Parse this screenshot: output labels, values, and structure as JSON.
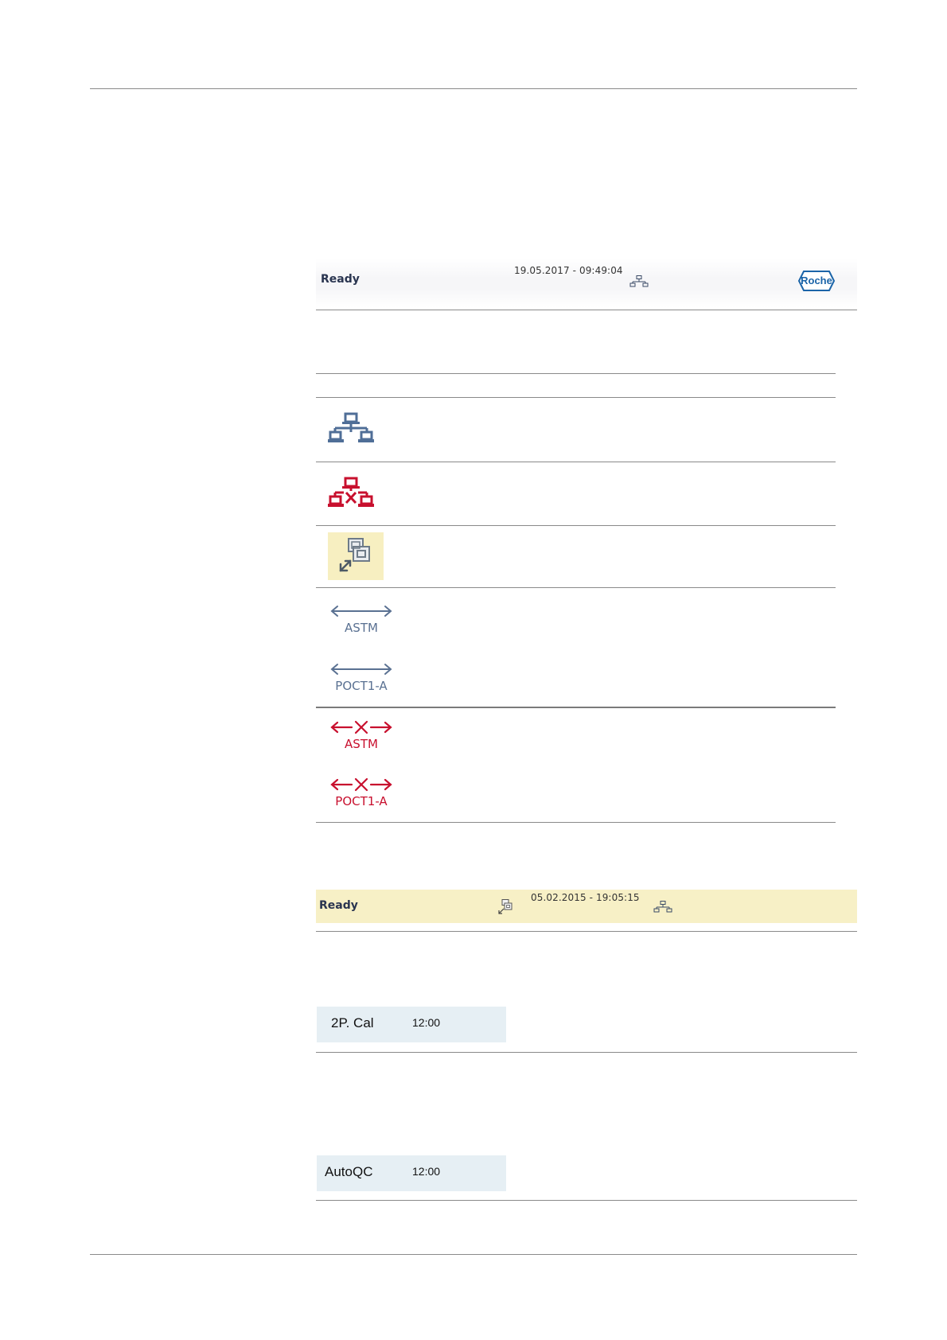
{
  "status_bar_ready": {
    "status": "Ready",
    "timestamp": "19.05.2017 - 09:49:04",
    "network_icon": "network-connected-icon",
    "logo_text": "Roche",
    "logo_color": "#1b64a8"
  },
  "icon_table": {
    "rows": [
      {
        "icon": "network-connected-icon",
        "color": "#4f6e97"
      },
      {
        "icon": "network-disconnected-icon",
        "color": "#c8102e"
      },
      {
        "icon": "remote-control-icon",
        "color": "#6e7b88",
        "background": "#f7efc1"
      },
      {
        "icon": "astm-connected-icon",
        "label": "ASTM",
        "color": "#5a7192"
      },
      {
        "icon": "poct1a-connected-icon",
        "label": "POCT1-A",
        "color": "#5a7192"
      },
      {
        "icon": "astm-disconnected-icon",
        "label": "ASTM",
        "color": "#c8102e"
      },
      {
        "icon": "poct1a-disconnected-icon",
        "label": "POCT1-A",
        "color": "#c8102e"
      }
    ]
  },
  "status_bar_remote": {
    "status": "Ready",
    "remote_icon": "remote-control-icon",
    "timestamp": "05.02.2015 - 19:05:15",
    "network_icon": "network-connected-icon",
    "background": "#f7f0c6"
  },
  "chips": [
    {
      "label": "2P. Cal",
      "time": "12:00"
    },
    {
      "label": "AutoQC",
      "time": "12:00"
    }
  ]
}
